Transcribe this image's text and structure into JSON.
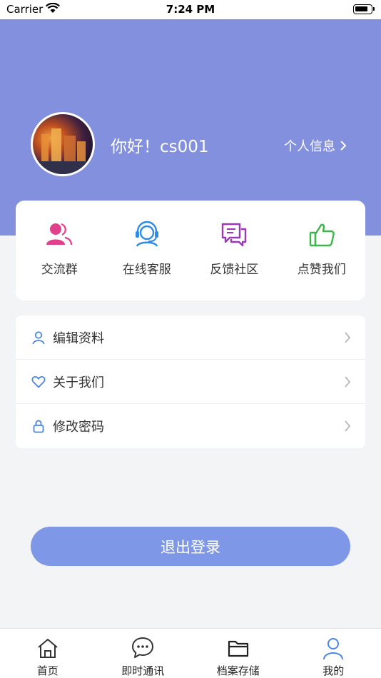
{
  "status_bar": {
    "carrier": "Carrier",
    "time": "7:24 PM"
  },
  "profile": {
    "greeting": "你好！cs001",
    "info_link": "个人信息"
  },
  "quick_actions": [
    {
      "label": "交流群",
      "icon": "group-icon",
      "color": "#e0408c"
    },
    {
      "label": "在线客服",
      "icon": "customer-service-icon",
      "color": "#2f8be6"
    },
    {
      "label": "反馈社区",
      "icon": "chat-bubbles-icon",
      "color": "#9b37b8"
    },
    {
      "label": "点赞我们",
      "icon": "thumbs-up-icon",
      "color": "#3cb54a"
    }
  ],
  "menu": [
    {
      "label": "编辑资料",
      "icon": "user-icon"
    },
    {
      "label": "关于我们",
      "icon": "heart-icon"
    },
    {
      "label": "修改密码",
      "icon": "lock-icon"
    }
  ],
  "logout_label": "退出登录",
  "tabs": [
    {
      "label": "首页",
      "icon": "home-icon"
    },
    {
      "label": "即时通讯",
      "icon": "message-icon"
    },
    {
      "label": "档案存储",
      "icon": "folder-icon"
    },
    {
      "label": "我的",
      "icon": "profile-icon",
      "active": true
    }
  ],
  "colors": {
    "header": "#8290de",
    "accent": "#4a86e8",
    "logout": "#7e97e6"
  }
}
